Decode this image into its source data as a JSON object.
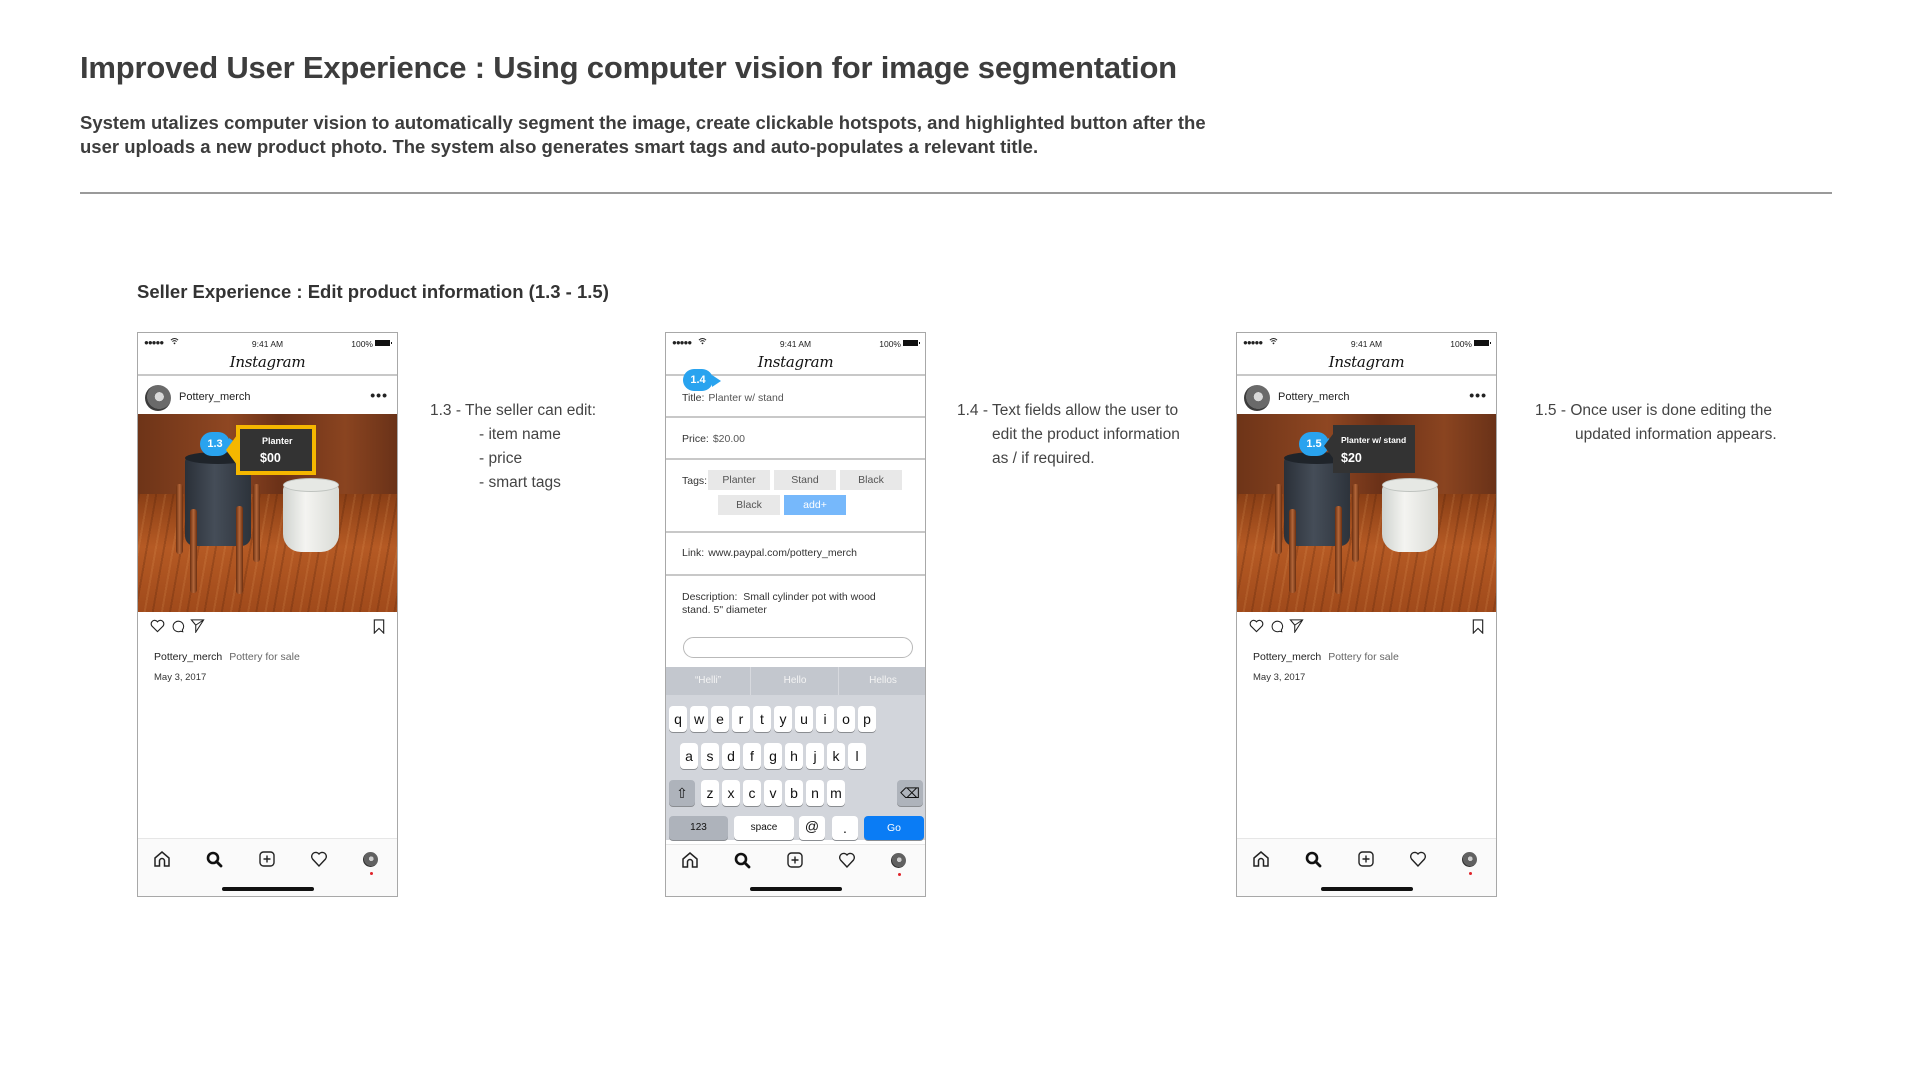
{
  "header": {
    "title": "Improved User Experience : Using computer vision for image segmentation",
    "description_line1": "System utalizes computer vision to automatically segment the image, create clickable hotspots, and highlighted button after the",
    "description_line2": "user uploads a new product photo.  The system also generates smart tags and auto-populates a relevant title."
  },
  "section": {
    "heading": "Seller Experience : Edit product information (1.3 - 1.5)"
  },
  "status_bar": {
    "signal": "●●●●●",
    "wifi": "wifi-icon",
    "time": "9:41 AM",
    "battery": "100%"
  },
  "app": {
    "logo": "Instagram"
  },
  "post": {
    "username": "Pottery_merch",
    "more": "•••",
    "caption_user": "Pottery_merch",
    "caption_text": "Pottery for sale",
    "date": "May 3, 2017"
  },
  "screens": {
    "s13": {
      "hotspot": "1.3",
      "tag_name": "Planter",
      "tag_price": "$00",
      "highlight_color": "#f5b700"
    },
    "s14": {
      "hotspot": "1.4",
      "title_label": "Title:",
      "title_value": "Planter w/ stand",
      "price_label": "Price:",
      "price_value": "$20.00",
      "tags_label": "Tags:",
      "tags": [
        "Planter",
        "Stand",
        "Black",
        "Black"
      ],
      "add_tag": "add+",
      "link_label": "Link:",
      "link_value": "www.paypal.com/pottery_merch",
      "description_label": "Description:",
      "description_value": "Small cylinder pot with wood stand.  5\" diameter",
      "input_value": "",
      "suggestions": [
        "“Helli”",
        "Hello",
        "Hellos"
      ],
      "keyboard": {
        "row1": [
          "q",
          "w",
          "e",
          "r",
          "t",
          "y",
          "u",
          "i",
          "o",
          "p"
        ],
        "row2": [
          "a",
          "s",
          "d",
          "f",
          "g",
          "h",
          "j",
          "k",
          "l"
        ],
        "row3": [
          "z",
          "x",
          "c",
          "v",
          "b",
          "n",
          "m"
        ],
        "shift": "⇧",
        "delete": "⌫",
        "numbers": "123",
        "space": "space",
        "at": "@",
        "dot": ".",
        "go": "Go"
      }
    },
    "s15": {
      "hotspot": "1.5",
      "tag_name": "Planter w/ stand",
      "tag_price": "$20"
    }
  },
  "annotations": {
    "a13": {
      "line1": "1.3 - The seller can edit:",
      "items": [
        "- item name",
        "- price",
        "- smart tags"
      ]
    },
    "a14": {
      "line1": "1.4 - Text fields allow the user to",
      "line2": "edit the product information",
      "line3": "as / if required."
    },
    "a15": {
      "line1": "1.5 - Once user is done editing the",
      "line2": "updated information appears."
    }
  },
  "colors": {
    "hotspot": "#29a3ef",
    "go_key": "#0a7cf5",
    "add_tag": "#76b8fb",
    "tag_highlight": "#f5b700"
  },
  "tab_bar": [
    "home-icon",
    "search-icon",
    "add-post-icon",
    "activity-heart-icon",
    "profile-avatar"
  ]
}
